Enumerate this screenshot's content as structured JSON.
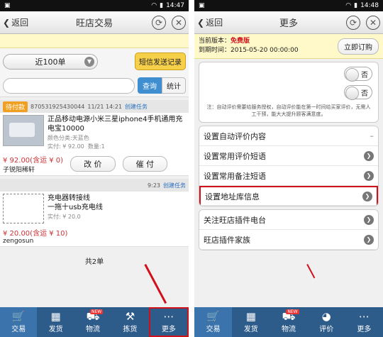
{
  "status": {
    "left_time": "14:47",
    "right_time": "14:48"
  },
  "left": {
    "back": "返回",
    "title": "旺店交易",
    "order_select": "近100单",
    "sms_btn": "短信发送记录",
    "query_btn": "查询",
    "stats_btn": "统计",
    "order1": {
      "badge": "待付款",
      "order_no": "870531925430044",
      "time": "11/21 14:21",
      "task": "创建任务",
      "title": "正品移动电源小米三星iphone4手机通用充电宝10000",
      "spec": "颜色分类:天蓝色",
      "paid": "实付: ¥ 92.00",
      "qty": "数量:1",
      "price": "¥ 92.00(含运 ¥ 0)",
      "buyer": "子锐阳稀轩",
      "btn1": "改 价",
      "btn2": "催 付"
    },
    "order2": {
      "time": "9:23",
      "task": "创建任务",
      "title": "一拖十usb充电线",
      "title_line1": "充电器转接线",
      "paid": "实付: ¥ 20.0",
      "price": "¥ 20.00(含运 ¥ 10)",
      "buyer": "zengosun"
    },
    "total": "共2单",
    "tabs": [
      "交易",
      "发货",
      "物流",
      "拣货",
      "更多"
    ],
    "new": "NEW"
  },
  "right": {
    "back": "返回",
    "title": "更多",
    "version_label": "当前版本：",
    "version": "免费版",
    "expire_label": "到期时间：",
    "expire": "2015-05-20 00:00:00",
    "subscribe_btn": "立即订购",
    "switch_no": "否",
    "note": "注：自动评价需要给服务授权，自动评价能在第一时间给买家评价，无需人工干预，能大大提升顾客满意度。",
    "menu1": [
      "设置自动评价内容",
      "设置常用评价短语",
      "设置常用备注短语",
      "设置地址库信息"
    ],
    "menu2": [
      "关注旺店插件电台",
      "旺店插件家族"
    ],
    "tabs": [
      "交易",
      "发货",
      "物流",
      "评价",
      "更多"
    ],
    "new": "NEW"
  }
}
